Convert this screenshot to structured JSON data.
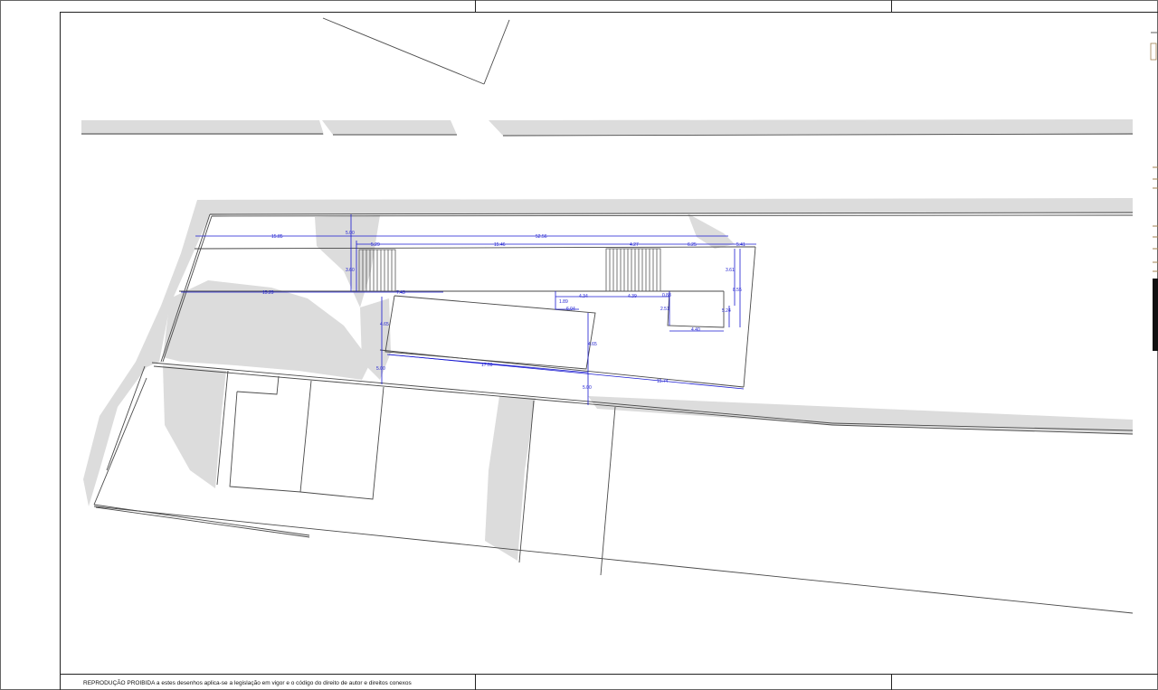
{
  "footer": {
    "notice": "REPRODUÇÃO PROIBIDA   a estes desenhos aplica-se a legislação em vigor e o código do direito de autor e direitos conexos"
  },
  "dimensions": {
    "d_1585": "15.85",
    "d_500_top": "5.00",
    "d_5256": "52.56",
    "d_529": "5.29",
    "d_1646": "15.46",
    "d_427": "4.27",
    "d_625": "6.25",
    "d_541": "5.41",
    "d_360": "3.60",
    "d_1529": "15.29",
    "d_743": "7.43",
    "d_189": "1.89",
    "d_604": "6.04",
    "d_434": "4.34",
    "d_439": "4.39",
    "d_088": "0.88",
    "d_361": "3.61",
    "d_855": "8.55",
    "d_251": "2.51",
    "d_524": "5.24",
    "d_440": "4.40",
    "d_465_left": "4.65",
    "d_465_right": "4.65",
    "d_1709": "17.09",
    "d_500_mid": "5.00",
    "d_500_low": "5.00",
    "d_1574": "15.74"
  },
  "colors": {
    "dimension_line": "#1a1ad0",
    "shadow": "#d9d9d9",
    "linework": "#4a4a4a"
  }
}
